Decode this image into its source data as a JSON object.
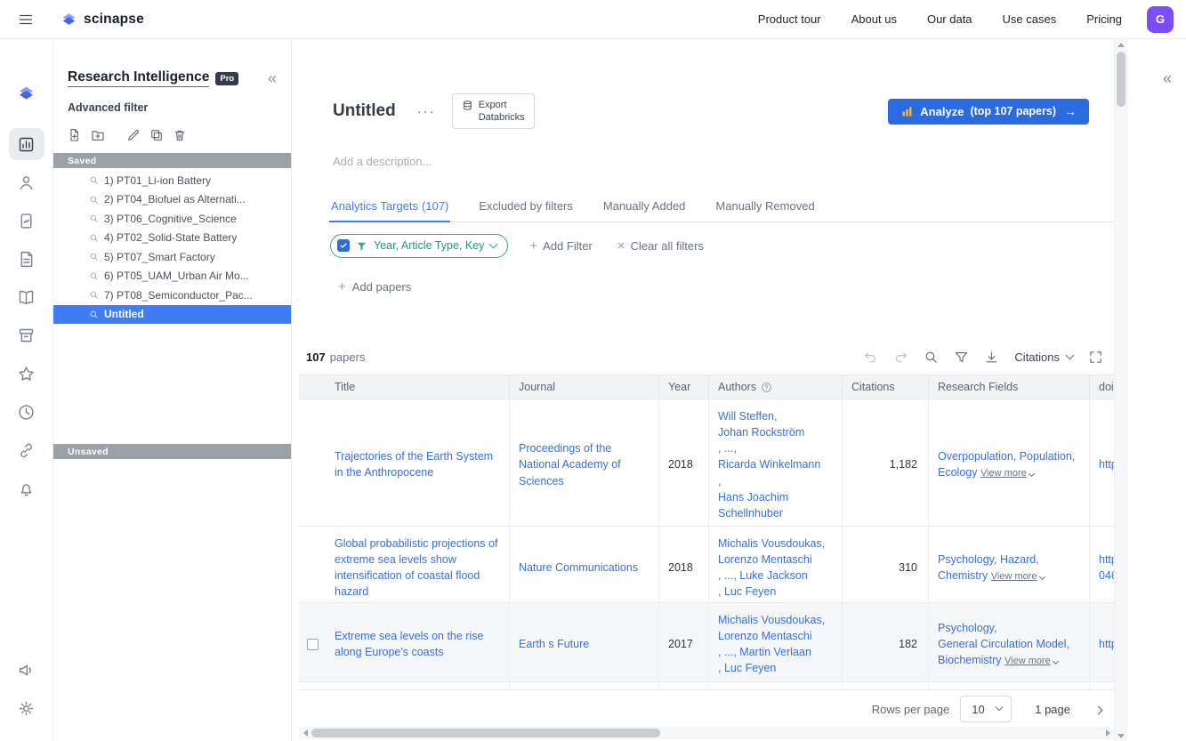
{
  "topbar": {
    "brand": "scinapse",
    "nav": [
      {
        "label": "Product tour"
      },
      {
        "label": "About us"
      },
      {
        "label": "Our data"
      },
      {
        "label": "Use cases"
      },
      {
        "label": "Pricing"
      }
    ],
    "avatar_initial": "G"
  },
  "sidebar": {
    "title": "Research Intelligence",
    "pro_badge": "Pro",
    "collapse_glyph": "«",
    "subtitle": "Advanced filter",
    "saved_header": "Saved",
    "unsaved_header": "Unsaved",
    "items": [
      {
        "label": "1) PT01_Li-ion Battery"
      },
      {
        "label": "2) PT04_Biofuel as Alternati..."
      },
      {
        "label": "3) PT06_Cognitive_Science"
      },
      {
        "label": "4) PT02_Solid-State Battery"
      },
      {
        "label": "5) PT07_Smart Factory"
      },
      {
        "label": "6) PT05_UAM_Urban Air Mo..."
      },
      {
        "label": "7) PT08_Semiconductor_Pac..."
      },
      {
        "label": "Untitled"
      }
    ]
  },
  "main": {
    "title": "Untitled",
    "more_glyph": "···",
    "export_button": {
      "line1": "Export",
      "line2": "Databricks"
    },
    "analyze": {
      "label": "Analyze",
      "sub": "(top 107 papers)",
      "arrow": "→"
    },
    "description_placeholder": "Add a description...",
    "tabs": [
      {
        "label": "Analytics Targets",
        "count": "(107)"
      },
      {
        "label": "Excluded by filters"
      },
      {
        "label": "Manually Added"
      },
      {
        "label": "Manually Removed"
      }
    ],
    "filters": {
      "pill_label": "Year, Article Type, Key",
      "add_filter_plus": "+",
      "add_filter": "Add Filter",
      "clear_x": "×",
      "clear_all": "Clear all filters"
    },
    "add_papers_plus": "+",
    "add_papers": "Add papers",
    "count": {
      "value": "107",
      "word": "papers"
    },
    "toolbar": {
      "sort_label": "Citations"
    },
    "table": {
      "columns": {
        "title": "Title",
        "journal": "Journal",
        "year": "Year",
        "authors": "Authors",
        "citations": "Citations",
        "fields": "Research Fields",
        "doi": "doi"
      },
      "view_more": "View more",
      "rows": [
        {
          "title": "Trajectories of the Earth System in the Anthropocene",
          "journal": "Proceedings of the National Academy of Sciences",
          "year": "2018",
          "authors": "Will Steffen,\nJohan Rockström\n, ...,\nRicarda Winkelmann\n,\nHans Joachim Schellnhuber",
          "citations": "1,182",
          "fields": "Overpopulation, Population, Ecology",
          "doi": "http"
        },
        {
          "title": "Global probabilistic projections of extreme sea levels show intensification of coastal flood hazard",
          "journal": "Nature Communications",
          "year": "2018",
          "authors": "Michalis Vousdoukas,\nLorenzo Mentaschi\n, ..., Luke Jackson\n, Luc Feyen",
          "citations": "310",
          "fields": "Psychology, Hazard, Chemistry",
          "doi": "http\n046"
        },
        {
          "title": "Extreme sea levels on the rise along Europe's coasts",
          "journal": "Earth s Future",
          "year": "2017",
          "authors": "Michalis Vousdoukas,\nLorenzo Mentaschi\n, ..., Martin Verlaan\n, Luc Feyen",
          "citations": "182",
          "fields": "Psychology,\nGeneral Circulation Model,\nBiochemistry",
          "doi": "http"
        }
      ]
    },
    "pagination": {
      "rows_per_page_label": "Rows per page",
      "rows_per_page_value": "10",
      "page_info": "1 page"
    }
  },
  "colors": {
    "accent_blue": "#2a6bdf",
    "link_blue": "#3c6fd3",
    "tab_active_blue": "#3e7df6",
    "selected_item_blue": "#3e7df6",
    "pill_green": "#2fae7d",
    "avatar_purple": "#7a4ff1",
    "section_bar_gray": "#9aa1a9"
  }
}
